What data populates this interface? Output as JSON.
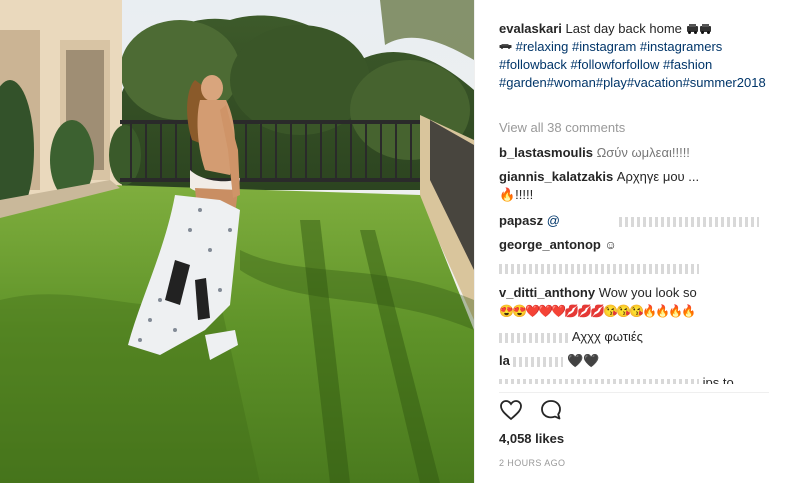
{
  "post": {
    "username": "evalaskari",
    "caption_text": "Last day back home",
    "hashtags": "#relaxing #instagram #instagramers #followback #followforfollow #fashion #garden#woman#play#vacation#summer2018",
    "view_all_comments": "View all 38 comments",
    "likes": "4,058 likes",
    "timestamp": "2 HOURS AGO"
  },
  "comments": [
    {
      "user": "b_lastasmoulis",
      "text": "Ωσύν ωμλεαι!!!!!"
    },
    {
      "user": "giannis_kalatzakis",
      "text": "Αρχηγε μου ..."
    },
    {
      "user": "",
      "text": "🔥!!!!!"
    },
    {
      "user": "papasz",
      "text": "@"
    },
    {
      "user": "george_antonop",
      "text": ""
    },
    {
      "user": "",
      "text": ""
    },
    {
      "user": "v_ditti_anthony",
      "text": "Wow you look so"
    },
    {
      "user": "",
      "text": "Αχχχ φωτιές"
    },
    {
      "user": "la",
      "text": "🖤🖤"
    },
    {
      "user": "",
      "text": "ips to"
    }
  ],
  "emoji_row": [
    "😍",
    "😍",
    "❤️",
    "❤️",
    "❤️",
    "💋",
    "💋",
    "💋",
    "😘",
    "😘",
    "😘",
    "🔥",
    "🔥",
    "🔥",
    "🔥"
  ],
  "icons": {
    "like": "heart-outline-icon",
    "comment": "comment-bubble-icon",
    "caption_emoji": "car-emoji"
  },
  "colors": {
    "link": "#003569",
    "muted": "#999999",
    "text": "#262626",
    "divider": "#efefef"
  }
}
